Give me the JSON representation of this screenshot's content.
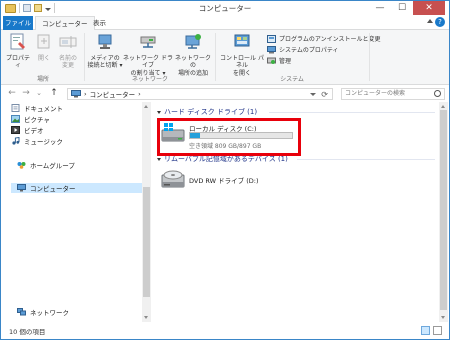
{
  "window": {
    "title": "コンピューター",
    "minimize": "—",
    "maximize": "☐",
    "close": "✕"
  },
  "ribbon_tabs": {
    "file": "ファイル",
    "computer": "コンピューター",
    "view": "表示",
    "help": "?"
  },
  "ribbon": {
    "location": {
      "properties": "プロパティ",
      "open": "開く",
      "rename_line1": "名前の",
      "rename_line2": "変更",
      "group_label": "場所"
    },
    "network": {
      "media_line1": "メディアの",
      "media_line2": "接続と切断 ▾",
      "map_drive_line1": "ネットワーク ドライブ",
      "map_drive_line2": "の割り当て ▾",
      "add_location_line1": "ネットワークの",
      "add_location_line2": "場所の追加",
      "group_label": "ネットワーク"
    },
    "system": {
      "control_panel_line1": "コントロール パネル",
      "control_panel_line2": "を開く",
      "uninstall": "プログラムのアンインストールと変更",
      "system_properties": "システムのプロパティ",
      "manage": "管理",
      "group_label": "システム"
    }
  },
  "address": {
    "sep1": "›",
    "crumb": "コンピューター",
    "sep2": "›",
    "refresh": "⟳",
    "search_placeholder": "コンピューターの検索"
  },
  "nav": {
    "back": "←",
    "forward": "→",
    "recent": "⌄",
    "up": "↑",
    "items": [
      {
        "label": "ドキュメント",
        "icon": "documents-icon"
      },
      {
        "label": "ピクチャ",
        "icon": "pictures-icon"
      },
      {
        "label": "ビデオ",
        "icon": "videos-icon"
      },
      {
        "label": "ミュージック",
        "icon": "music-icon"
      }
    ],
    "homegroup": "ホームグループ",
    "computer": "コンピューター",
    "network": "ネットワーク"
  },
  "content": {
    "hdd_group": "ハード ディスク ドライブ (1)",
    "removable_group": "リムーバブル記憶域があるデバイス (1)",
    "drive_c": {
      "name": "ローカル ディスク (C:)",
      "free_text": "空き領域 809 GB/897 GB",
      "used_fraction": 0.098
    },
    "drive_d": {
      "name": "DVD RW ドライブ (D:)"
    }
  },
  "status": {
    "item_count": "10 個の項目"
  },
  "colors": {
    "accent": "#1979ca",
    "drive_bar": "#26a0da",
    "highlight": "#e8000b",
    "group_header": "#1e3287"
  }
}
